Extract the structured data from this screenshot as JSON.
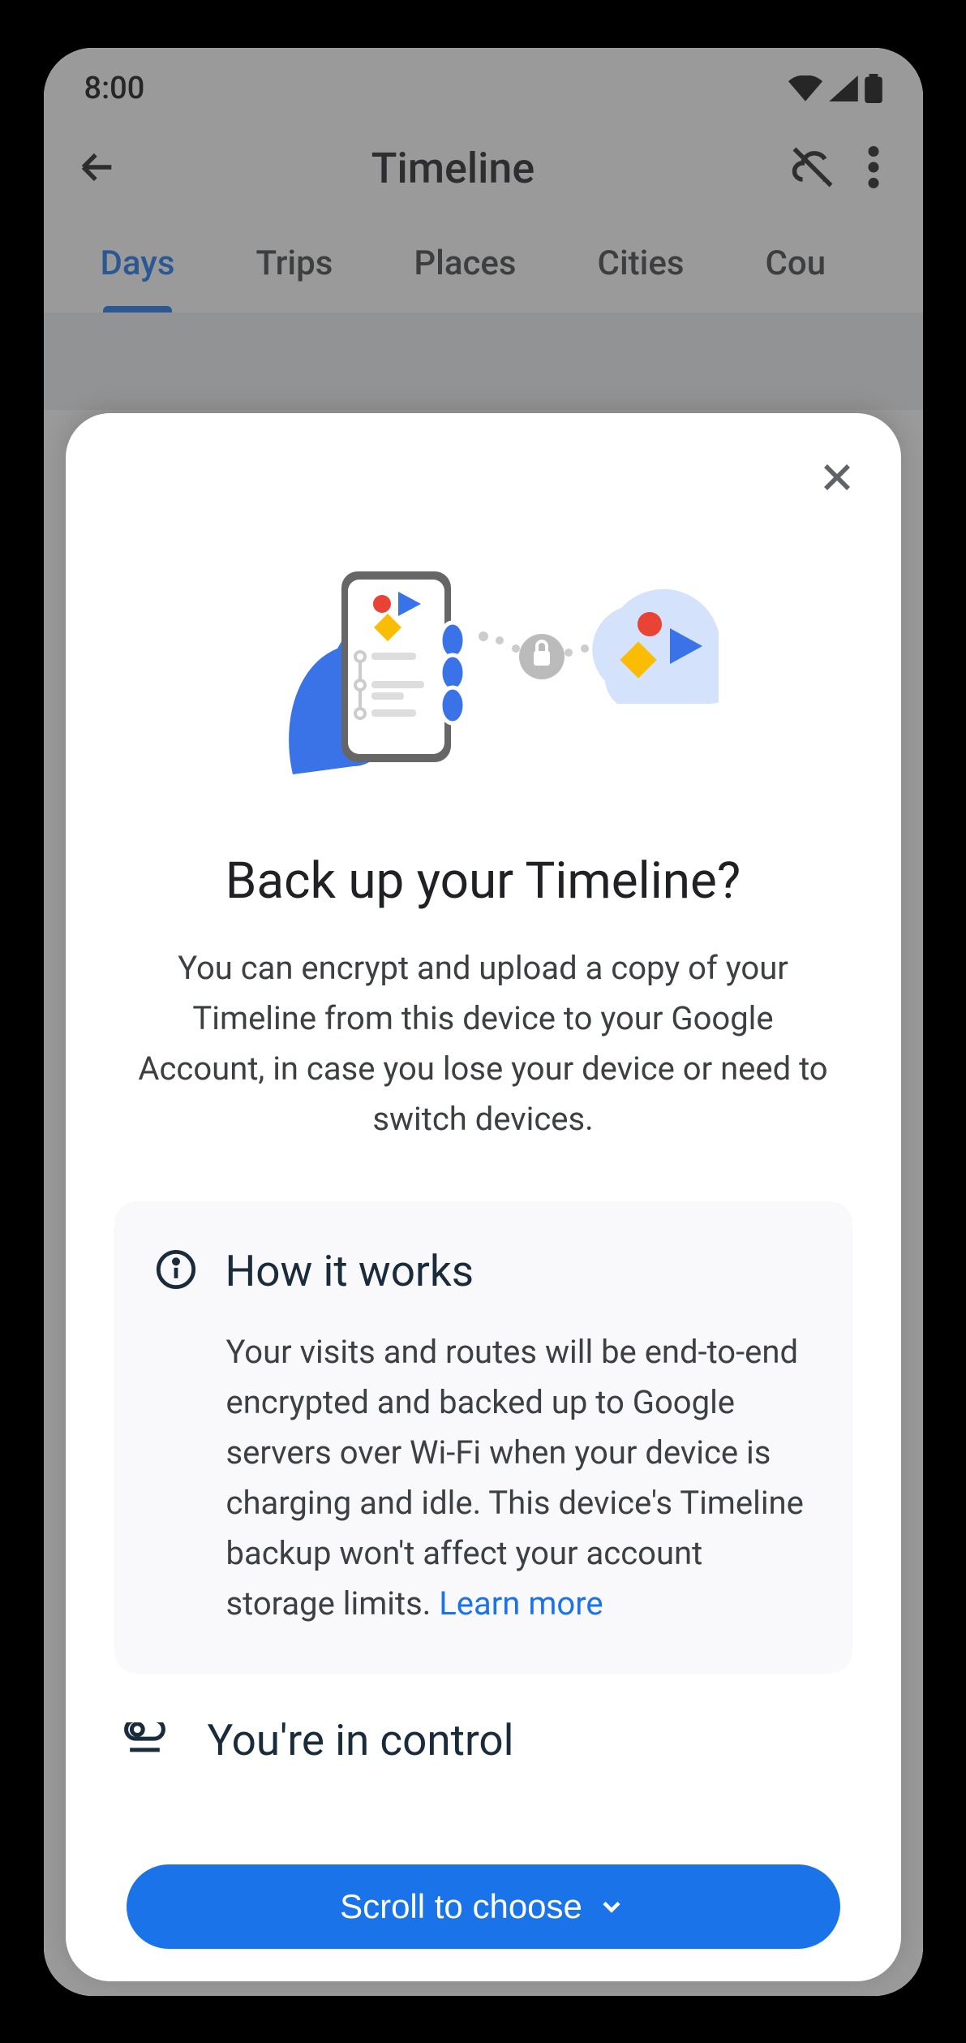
{
  "status": {
    "time": "8:00"
  },
  "appbar": {
    "title": "Timeline"
  },
  "tabs": [
    "Days",
    "Trips",
    "Places",
    "Cities",
    "Cou"
  ],
  "sheet": {
    "title": "Back up your Timeline?",
    "description": "You can encrypt and upload a copy of your Timeline from this device to your Google Account, in case you lose your device or need to switch devices.",
    "info": {
      "heading": "How it works",
      "body": "Your visits and routes will be end-to-end encrypted and backed up to Google servers over Wi-Fi when your device is charging and idle. This device's Timeline backup won't affect your account storage limits. ",
      "learn_more": "Learn more"
    },
    "control_teaser": "You're in control",
    "scroll_button": "Scroll to choose"
  }
}
